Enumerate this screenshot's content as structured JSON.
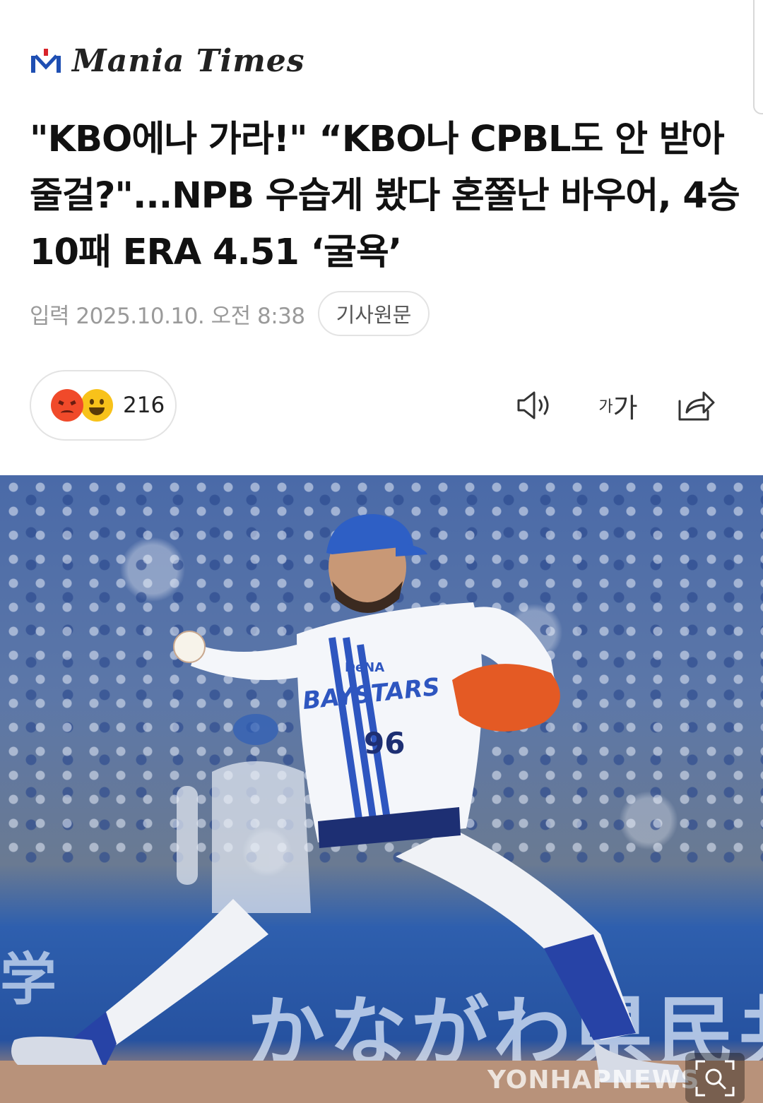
{
  "header": {
    "logo_text": "Mania Times",
    "logo_icon": "mania-times-logo"
  },
  "article": {
    "headline": "\"KBO에나 가라!\" “KBO나 CPBL도 안 받아줄걸?\"...NPB 우습게 봤다 혼쭐난 바우어, 4승 10패 ERA 4.51 ‘굴욕’",
    "date": "입력 2025.10.10. 오전 8:38",
    "original_label": "기사원문"
  },
  "reactions": {
    "count": "216",
    "icons": [
      "angry-emoji-icon",
      "happy-emoji-icon"
    ]
  },
  "toolbar": {
    "speaker_icon": "speaker-icon",
    "font_small": "가",
    "font_big": "가",
    "share_icon": "share-icon"
  },
  "photo": {
    "jersey_text": "BAYSTARS",
    "jersey_number": "96",
    "jersey_sponsor": "DeNA",
    "banner_text": "かながわ県民共済",
    "banner_left": "学",
    "watermark": "YONHAPNEWS",
    "zoom_icon": "zoom-icon"
  },
  "colors": {
    "text_primary": "#111111",
    "text_meta": "#9a9a9a",
    "border": "#e3e3e3",
    "logo_accent": "#1f4fb3",
    "logo_red": "#d8232a"
  }
}
